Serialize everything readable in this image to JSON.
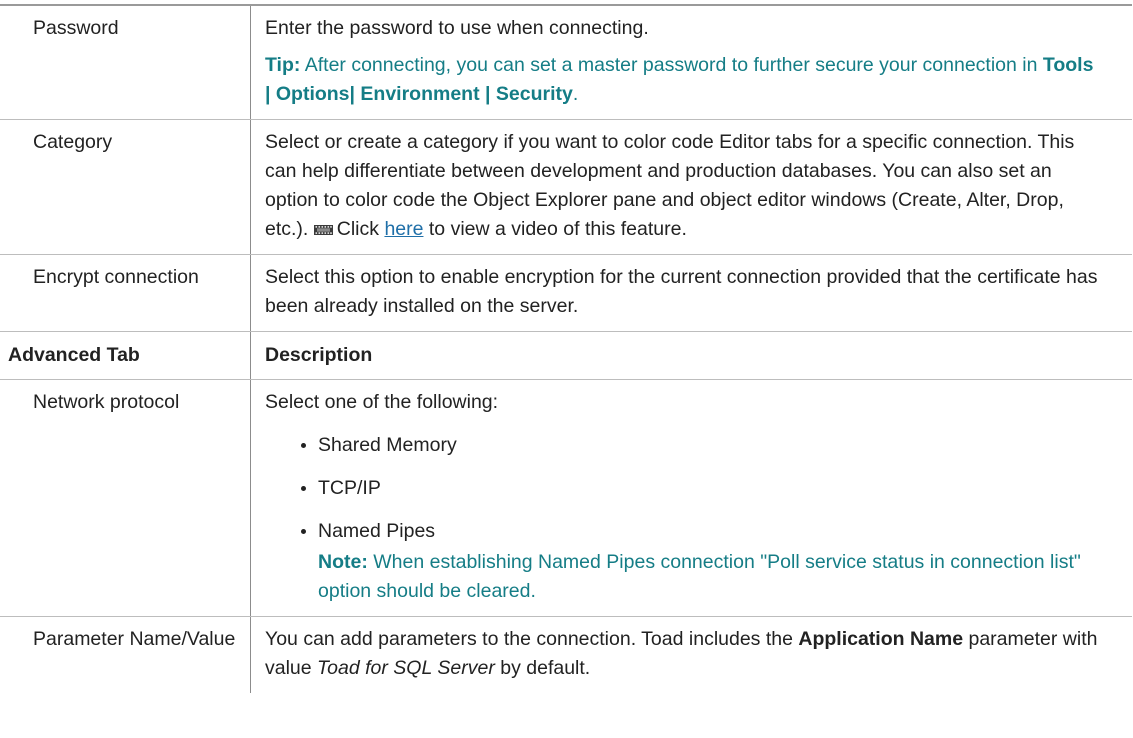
{
  "rows": {
    "password": {
      "label": "Password",
      "description": "Enter the password to use when connecting.",
      "tip_label": "Tip:",
      "tip_text": " After connecting, you can set a master password to further secure your connection in ",
      "tip_path": "Tools | Options| Environment | Security",
      "tip_end": "."
    },
    "category": {
      "label": "Category",
      "description": "Select or create a category if you want to color code Editor tabs for a specific connection. This can help differentiate between development and production databases. You can also set an option to color code the Object Explorer pane and object editor windows (Create, Alter, Drop, etc.). ",
      "click_text": "Click ",
      "link_text": "here",
      "after_link": " to view a video of this feature."
    },
    "encrypt": {
      "label": "Encrypt connection",
      "description": "Select this option to enable encryption for the current connection provided that the certificate has been already installed on the server."
    }
  },
  "advanced_header": {
    "col1": "Advanced Tab",
    "col2": "Description"
  },
  "network": {
    "label": "Network protocol",
    "intro": "Select one of the following:",
    "options": [
      "Shared Memory",
      "TCP/IP",
      "Named Pipes"
    ],
    "note_label": "Note:",
    "note_text": " When establishing Named Pipes connection \"Poll service status in connection list\" option should be cleared."
  },
  "parameter": {
    "label": "Parameter Name/Value",
    "text1": "You can add parameters to the connection. Toad includes the ",
    "bold1": "Application Name",
    "text2": " parameter with value ",
    "ital1": "Toad for SQL Server",
    "text3": " by default."
  },
  "colors": {
    "accent_teal": "#157d86",
    "link_blue": "#1f6fa8",
    "text": "#222222"
  },
  "icons": [
    "video-icon",
    "bullet-icon"
  ]
}
